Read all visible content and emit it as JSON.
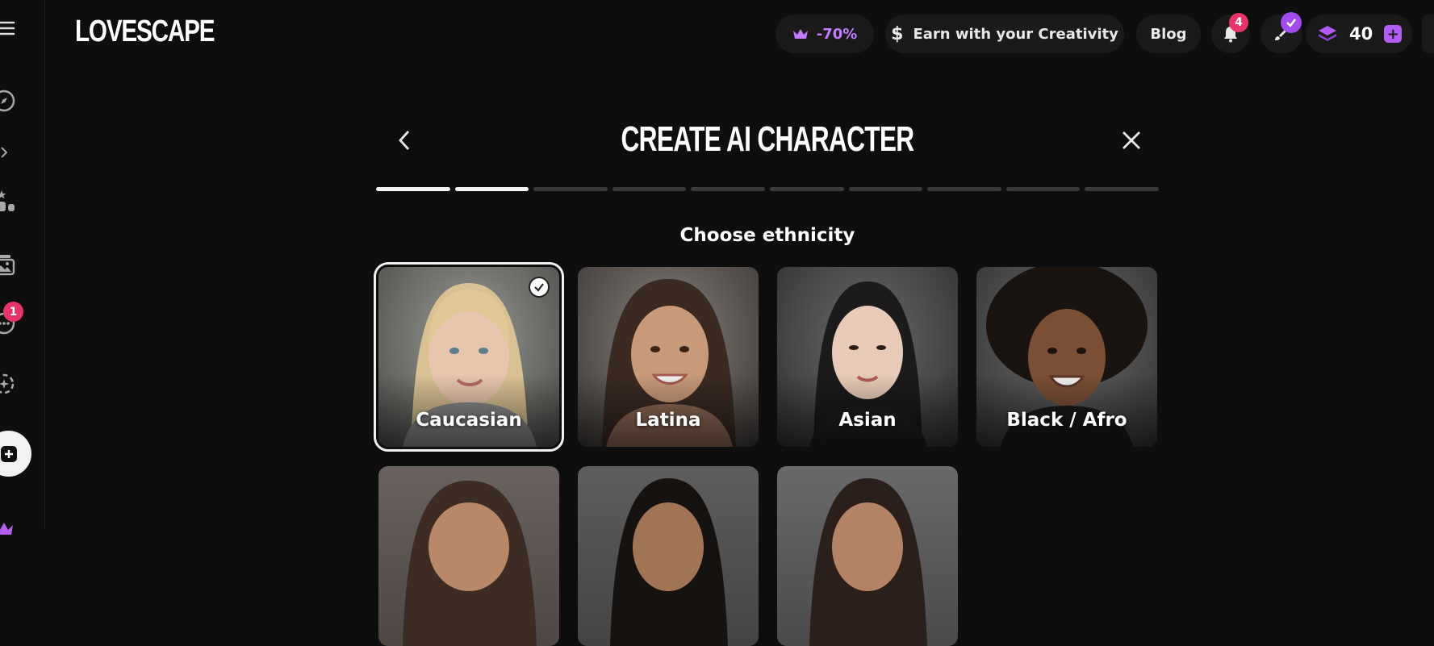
{
  "app": {
    "logo": "LOVESCAPE"
  },
  "topbar": {
    "discount_label": "-70%",
    "earn_label": "Earn with your Creativity",
    "blog_label": "Blog",
    "notifications_count": "4",
    "credits": "40"
  },
  "sidebar": {
    "messages_badge": "1"
  },
  "wizard": {
    "title": "CREATE AI CHARACTER",
    "subtitle": "Choose ethnicity",
    "total_steps": 10,
    "completed_steps": 2
  },
  "options": [
    {
      "label": "Caucasian",
      "selected": true
    },
    {
      "label": "Latina",
      "selected": false
    },
    {
      "label": "Asian",
      "selected": false
    },
    {
      "label": "Black / Afro",
      "selected": false
    }
  ],
  "colors": {
    "accent": "#b25ef5",
    "badge": "#e9346b",
    "background": "#0e0e0e",
    "pill": "#1a1a1a"
  }
}
